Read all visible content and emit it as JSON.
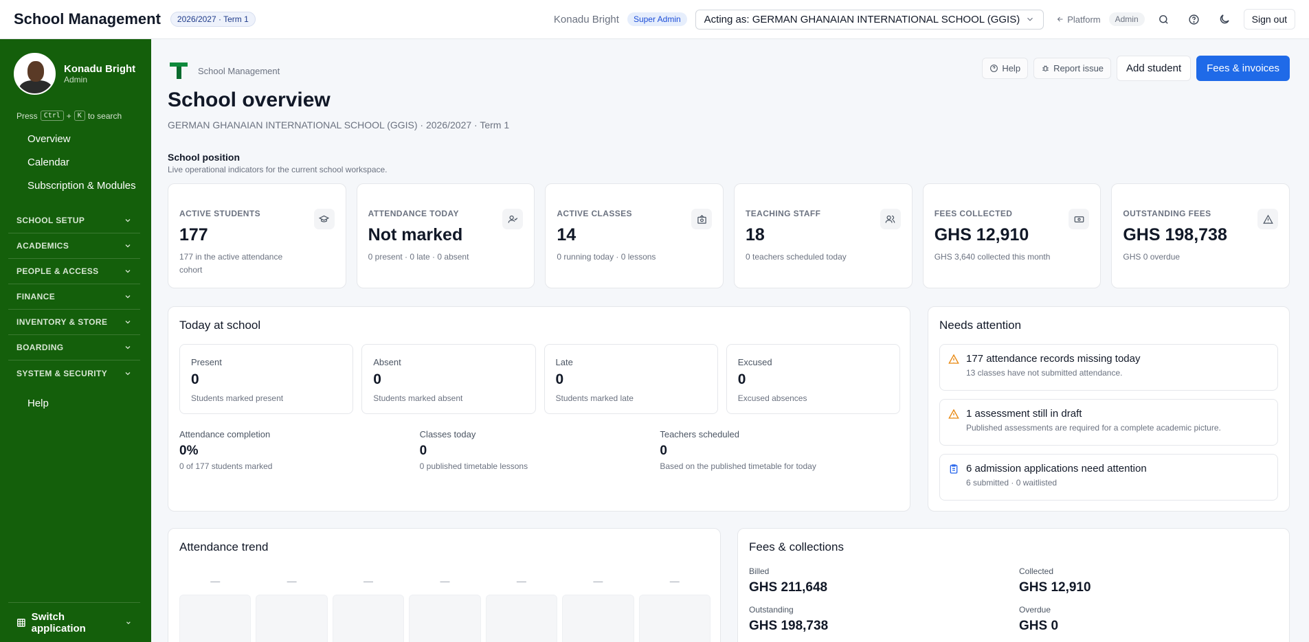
{
  "header": {
    "app_title": "School Management",
    "term": "2026/2027 · Term 1",
    "user_name": "Konadu Bright",
    "role": "Super Admin",
    "acting_as": "Acting as: GERMAN GHANAIAN INTERNATIONAL SCHOOL (GGIS)",
    "platform_label": "Platform",
    "admin_label": "Admin",
    "sign_out": "Sign out"
  },
  "sidebar": {
    "profile_name": "Konadu Bright",
    "profile_role": "Admin",
    "search_hint_pre": "Press",
    "search_key_1": "Ctrl",
    "search_plus": "+",
    "search_key_2": "K",
    "search_hint_post": "to search",
    "links": [
      "Overview",
      "Calendar",
      "Subscription & Modules"
    ],
    "groups": [
      "SCHOOL SETUP",
      "ACADEMICS",
      "PEOPLE & ACCESS",
      "FINANCE",
      "INVENTORY & STORE",
      "BOARDING",
      "SYSTEM & SECURITY"
    ],
    "help": "Help",
    "switch_app": "Switch application"
  },
  "page": {
    "brand": "School Management",
    "help_btn": "Help",
    "report_btn": "Report issue",
    "add_student_btn": "Add student",
    "fees_btn": "Fees & invoices",
    "title": "School overview",
    "subtitle": "GERMAN GHANAIAN INTERNATIONAL SCHOOL (GGIS) · 2026/2027 · Term 1",
    "section_title": "School position",
    "section_sub": "Live operational indicators for the current school workspace."
  },
  "stats": [
    {
      "label": "ACTIVE STUDENTS",
      "value": "177",
      "note": "177 in the active attendance cohort",
      "icon": "graduation-cap-icon"
    },
    {
      "label": "ATTENDANCE TODAY",
      "value": "Not marked",
      "note": "0 present · 0 late · 0 absent",
      "icon": "user-check-icon"
    },
    {
      "label": "ACTIVE CLASSES",
      "value": "14",
      "note": "0 running today · 0 lessons",
      "icon": "school-icon"
    },
    {
      "label": "TEACHING STAFF",
      "value": "18",
      "note": "0 teachers scheduled today",
      "icon": "users-icon"
    },
    {
      "label": "FEES COLLECTED",
      "value": "GHS 12,910",
      "note": "GHS 3,640 collected this month",
      "icon": "banknote-icon"
    },
    {
      "label": "OUTSTANDING FEES",
      "value": "GHS 198,738",
      "note": "GHS 0 overdue",
      "icon": "warning-icon"
    }
  ],
  "today": {
    "title": "Today at school",
    "cards": [
      {
        "label": "Present",
        "value": "0",
        "note": "Students marked present"
      },
      {
        "label": "Absent",
        "value": "0",
        "note": "Students marked absent"
      },
      {
        "label": "Late",
        "value": "0",
        "note": "Students marked late"
      },
      {
        "label": "Excused",
        "value": "0",
        "note": "Excused absences"
      }
    ],
    "stats": [
      {
        "label": "Attendance completion",
        "value": "0%",
        "note": "0 of 177 students marked"
      },
      {
        "label": "Classes today",
        "value": "0",
        "note": "0 published timetable lessons"
      },
      {
        "label": "Teachers scheduled",
        "value": "0",
        "note": "Based on the published timetable for today"
      }
    ]
  },
  "attention": {
    "title": "Needs attention",
    "items": [
      {
        "title": "177 attendance records missing today",
        "note": "13 classes have not submitted attendance.",
        "icon": "warning-icon",
        "color": "#e8870e"
      },
      {
        "title": "1 assessment still in draft",
        "note": "Published assessments are required for a complete academic picture.",
        "icon": "warning-icon",
        "color": "#e8870e"
      },
      {
        "title": "6 admission applications need attention",
        "note": "6 submitted · 0 waitlisted",
        "icon": "clipboard-icon",
        "color": "#2563eb"
      }
    ]
  },
  "trend": {
    "title": "Attendance trend",
    "columns": [
      "—",
      "—",
      "—",
      "—",
      "—",
      "—",
      "—"
    ]
  },
  "fees": {
    "title": "Fees & collections",
    "items": [
      {
        "label": "Billed",
        "value": "GHS 211,648"
      },
      {
        "label": "Collected",
        "value": "GHS 12,910"
      },
      {
        "label": "Outstanding",
        "value": "GHS 198,738"
      },
      {
        "label": "Overdue",
        "value": "GHS 0"
      }
    ]
  },
  "colors": {
    "sidebar": "#145f0b",
    "primary": "#1f6ae8",
    "warning": "#e8870e"
  }
}
